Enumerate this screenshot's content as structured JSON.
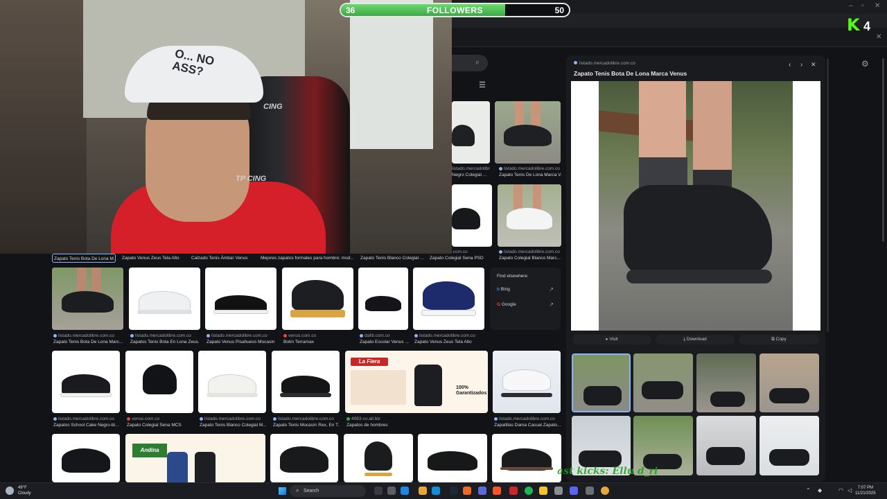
{
  "overlay": {
    "followers": {
      "current": "36",
      "goal": "50",
      "label": "FOLLOWERS",
      "progress": 0.72
    },
    "kick_count": "4",
    "webcam_cap_text": "O... NO\nASS?",
    "racing_text_1": "CING",
    "racing_text_2": "TP CING",
    "scrolling_text": "ast kicks: Ellu d_ri"
  },
  "chips": [
    "Zapato Tenis Bota De Lona M...",
    "Zapato Venus Zeus Tela Alto",
    "Calzado Tenis Ámbar Venus",
    "Mejores zapatos formales para hombre: mod...",
    "Zapato Tenis Blanco Colegial ...",
    "Zapato Colegial Sena PSD"
  ],
  "top_partial": [
    {
      "source": "listado.mercadolibre.com.co",
      "caption": "Negro Colegial ..."
    },
    {
      "source": "listado.mercadolibre.com.co",
      "caption": "Zapato Tenis De Lona Marca V..."
    },
    {
      "source": ".com.co",
      "caption": ""
    },
    {
      "source": "listado.mercadolibre.com.co",
      "caption": "Zapato Colegial Blanco Marc..."
    }
  ],
  "row2": [
    {
      "source": "listado.mercadolibre.com.co",
      "caption": "Zapato Tenis Bota De Lona Marc..."
    },
    {
      "source": "listado.mercadolibre.com.co",
      "caption": "Zapatos Tenis Bota En Lona Zeus..."
    },
    {
      "source": "listado.mercadolibre.com.co",
      "caption": "Zapato Venus Pisahuevo Mocasin"
    },
    {
      "source": "venus.com.co",
      "caption": "Botín Terramax"
    },
    {
      "source": "dafiti.com.co",
      "caption": "Zapato Escolar Venus ..."
    },
    {
      "source": "listado.mercadolibre.com.co",
      "caption": "Zapato Venus Zeus Tela Alto"
    }
  ],
  "row3": [
    {
      "source": "listado.mercadolibre.com.co",
      "caption": "Zapatos School Cake Negro-bl..."
    },
    {
      "source": "venus.com.co",
      "caption": "Zapato Colegial Sena MCS"
    },
    {
      "source": "listado.mercadolibre.com.co",
      "caption": "Zapato Tenis Blanco Colegial M..."
    },
    {
      "source": "listado.mercadolibre.com.co",
      "caption": "Zapato Tenis Mocasín Rex, En T..."
    },
    {
      "source": "4983-co.all.biz",
      "caption": "Zapatos de hombres"
    },
    {
      "source": "listado.mercadolibre.com.co",
      "caption": "Zapatillas Dama Casual Zapato..."
    }
  ],
  "ad_texts": {
    "la_fiera": "La Fiera",
    "garantia": "100% Garantizados",
    "andina": "Andina"
  },
  "find_elsewhere": {
    "heading": "Find elsewhere",
    "items": [
      "Bing",
      "Google"
    ]
  },
  "preview": {
    "domain": "listado.mercadolibre.com.co",
    "title": "Zapato Tenis Bota De Lona Marca Venus",
    "actions": [
      "Visit",
      "Download",
      "Copy"
    ]
  },
  "taskbar": {
    "temp": "49°F",
    "weather": "Cloudy",
    "search": "Search",
    "time": "7:07 PM",
    "date": "11/21/2025"
  },
  "colors": {
    "kick_green": "#53fc18",
    "bar_green": "#4cbf55",
    "shirt_red": "#d5202a"
  }
}
